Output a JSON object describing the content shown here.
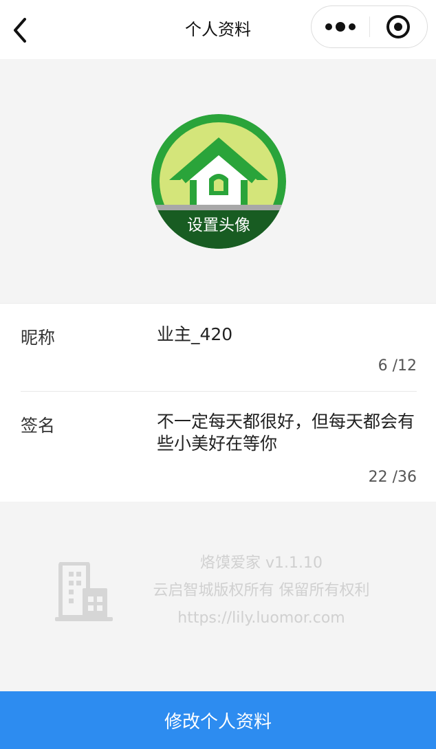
{
  "navbar": {
    "title": "个人资料",
    "back_icon": "chevron-left-icon",
    "more_icon": "more-dots-icon",
    "close_icon": "target-close-icon"
  },
  "avatar": {
    "label": "设置头像",
    "colors": {
      "ring": "#2aa43a",
      "field": "#d4e57a",
      "roof": "#2aa43a",
      "base": "#185c22"
    }
  },
  "profile": {
    "nickname_label": "昵称",
    "nickname_value": "业主_420",
    "nickname_count": "6 /12",
    "signature_label": "签名",
    "signature_value": "不一定每天都很好，但每天都会有些小美好在等你",
    "signature_count": "22 /36"
  },
  "footer": {
    "icon": "building-icon",
    "line1": "烙馍爱家 v1.1.10",
    "line2": "云启智城版权所有 保留所有权利",
    "line3": "https://lily.luomor.com"
  },
  "submit": {
    "label": "修改个人资料",
    "color": "#2d8cf0"
  }
}
